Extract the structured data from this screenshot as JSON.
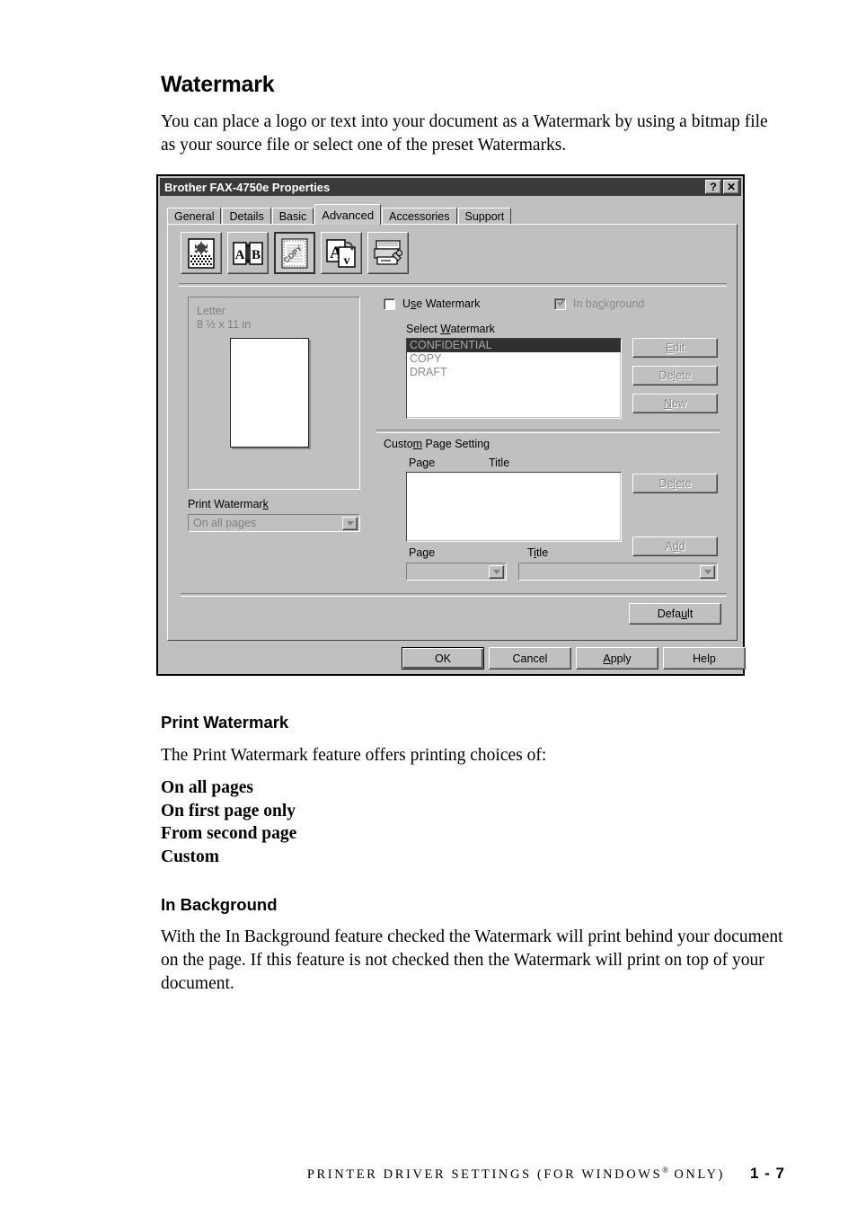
{
  "document": {
    "heading": "Watermark",
    "intro": "You can place a logo or text into your document as a Watermark by using a bitmap file as your source file or select one of the preset Watermarks.",
    "print_watermark": {
      "heading": "Print Watermark",
      "intro": "The Print Watermark feature offers printing choices of:",
      "choices": [
        "On all pages",
        "On first page only",
        "From second page",
        "Custom"
      ]
    },
    "in_background": {
      "heading": "In Background",
      "body": "With the In Background feature checked the Watermark will print behind your document on the page. If this feature is not checked then the Watermark will print on top of your document."
    },
    "footer": {
      "text_before": "PRINTER DRIVER SETTINGS (FOR WINDOWS",
      "registered_mark": "®",
      "text_after": " ONLY)",
      "page_number": "1 - 7"
    }
  },
  "dialog": {
    "title": "Brother FAX-4750e Properties",
    "titlebar_buttons": {
      "help": "?",
      "close": "✕"
    },
    "tabs": [
      {
        "label": "General",
        "active": false
      },
      {
        "label": "Details",
        "active": false
      },
      {
        "label": "Basic",
        "active": false
      },
      {
        "label": "Advanced",
        "active": true
      },
      {
        "label": "Accessories",
        "active": false
      },
      {
        "label": "Support",
        "active": false
      }
    ],
    "toolbar": [
      {
        "name": "halftone-image-icon",
        "selected": false
      },
      {
        "name": "duplex-ab-icon",
        "selected": false
      },
      {
        "name": "watermark-copy-icon",
        "selected": true
      },
      {
        "name": "font-rotate-icon",
        "selected": false
      },
      {
        "name": "device-options-icon",
        "selected": false
      }
    ],
    "preview": {
      "paper_size": "Letter",
      "paper_dimensions": "8 ½ x 11 in"
    },
    "print_watermark": {
      "label": "Print Watermark",
      "value": "On all pages",
      "disabled": true
    },
    "use_watermark": {
      "label": "Use Watermark",
      "checked": false,
      "disabled": false
    },
    "in_background": {
      "label": "In background",
      "checked": true,
      "disabled": true
    },
    "select_watermark": {
      "label": "Select Watermark",
      "items": [
        "CONFIDENTIAL",
        "COPY",
        "DRAFT"
      ],
      "selected_index": 0
    },
    "watermark_buttons": {
      "edit": "Edit",
      "delete": "Delete",
      "new": "New"
    },
    "custom_page_setting": {
      "label": "Custom Page Setting",
      "columns": [
        "Page",
        "Title"
      ],
      "rows": [],
      "delete_button": "Delete",
      "add_button": "Add",
      "page_field": {
        "label": "Page",
        "value": ""
      },
      "title_field": {
        "label": "Title",
        "value": ""
      }
    },
    "default_button": "Default",
    "footer_buttons": {
      "ok": "OK",
      "cancel": "Cancel",
      "apply": "Apply",
      "help": "Help"
    }
  },
  "colors": {
    "face": "#c0c0c0",
    "titlebar": "#3a3a3a",
    "highlight": "#303030",
    "disabled_text": "#8a8a8a",
    "window": "#ffffff"
  }
}
